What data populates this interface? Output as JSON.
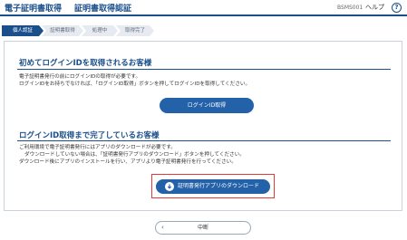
{
  "header": {
    "app_title": "電子証明書取得",
    "screen_title": "証明書取得認証",
    "screen_id": "BSMS001",
    "help": "ヘルプ",
    "help_icon": "?"
  },
  "steps": [
    {
      "label": "個人認証",
      "active": true
    },
    {
      "label": "証明書取得",
      "active": false
    },
    {
      "label": "処理中",
      "active": false
    },
    {
      "label": "取得完了",
      "active": false
    }
  ],
  "section1": {
    "title": "初めてログインIDを取得されるお客様",
    "lines": [
      "電子証明書発行の前にログインIDの取得が必要です。",
      "ログインIDをお持ちでなければ、「ログインID取得」ボタンを押してログインIDを取得してください。"
    ],
    "button": "ログインID取得"
  },
  "section2": {
    "title": "ログインID取得まで完了しているお客様",
    "lines": [
      "ご利用環境で電子証明書発行にはアプリのダウンロードが必要です。",
      "ダウンロードしていない場合は、「証明書発行アプリのダウンロード」ボタンを押してください。",
      "ダウンロード後にアプリのインストールを行い、アプリより電子証明書発行を行ってください。"
    ],
    "button": "証明書発行アプリのダウンロード",
    "button_icon": "cloud-download-icon"
  },
  "footer": {
    "cancel_label": "中断",
    "cancel_icon": "chevron-left-icon"
  },
  "colors": {
    "primary": "#1a4f8c",
    "button": "#2361a9",
    "highlight": "#e53935"
  }
}
